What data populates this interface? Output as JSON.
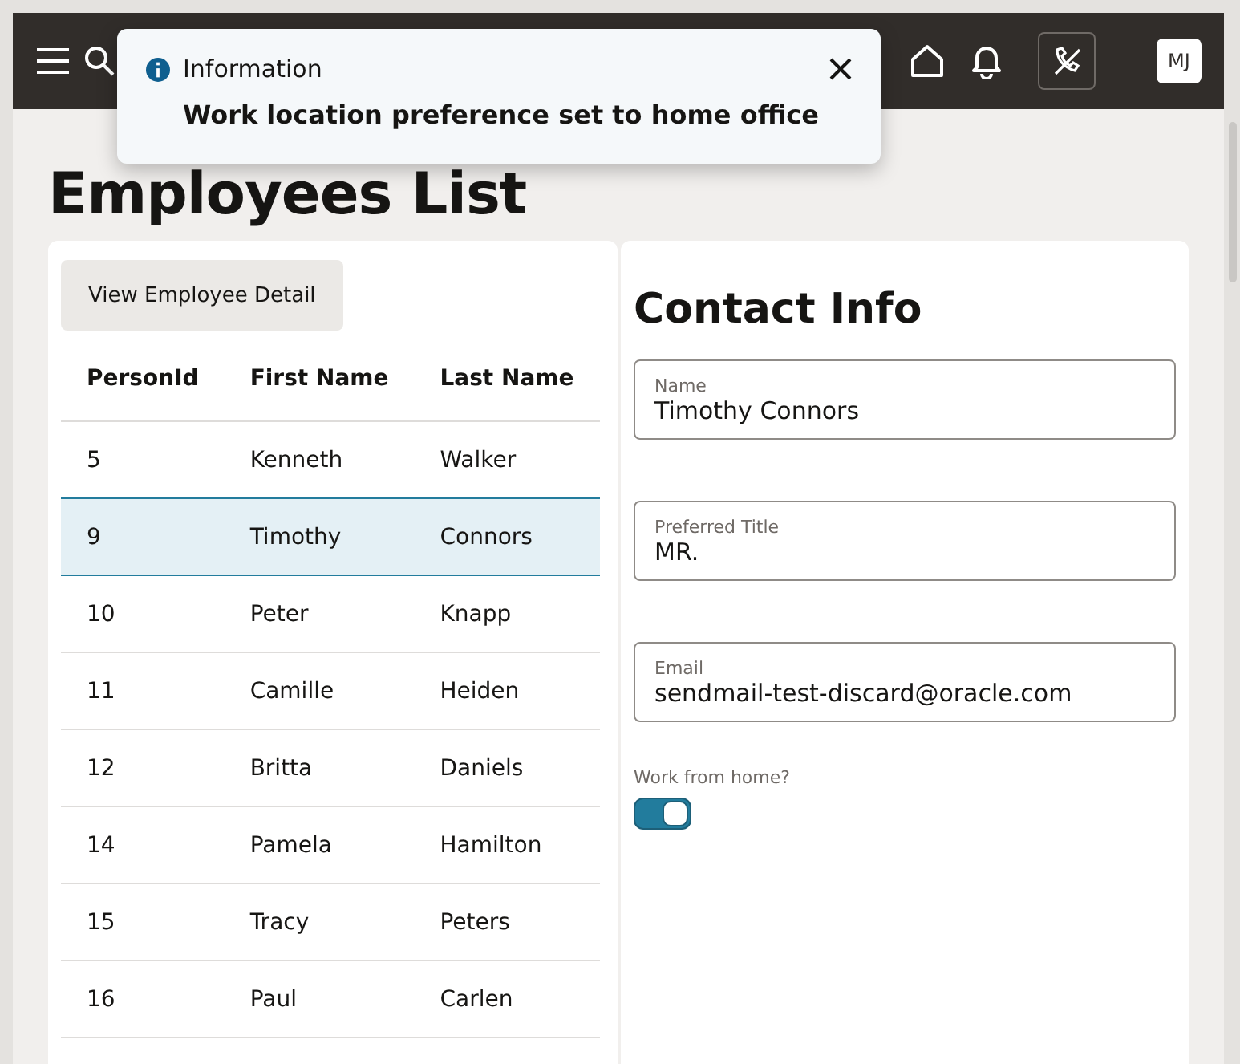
{
  "header": {
    "avatar": "MJ"
  },
  "toast": {
    "title": "Information",
    "message": "Work location preference set to home office"
  },
  "page": {
    "title": "Employees List"
  },
  "list_panel": {
    "button": "View Employee Detail",
    "table": {
      "columns": [
        "PersonId",
        "First Name",
        "Last Name"
      ],
      "rows": [
        {
          "cells": [
            "5",
            "Kenneth",
            "Walker"
          ],
          "selected": false
        },
        {
          "cells": [
            "9",
            "Timothy",
            "Connors"
          ],
          "selected": true
        },
        {
          "cells": [
            "10",
            "Peter",
            "Knapp"
          ],
          "selected": false
        },
        {
          "cells": [
            "11",
            "Camille",
            "Heiden"
          ],
          "selected": false
        },
        {
          "cells": [
            "12",
            "Britta",
            "Daniels"
          ],
          "selected": false
        },
        {
          "cells": [
            "14",
            "Pamela",
            "Hamilton"
          ],
          "selected": false
        },
        {
          "cells": [
            "15",
            "Tracy",
            "Peters"
          ],
          "selected": false
        },
        {
          "cells": [
            "16",
            "Paul",
            "Carlen"
          ],
          "selected": false
        }
      ]
    }
  },
  "contact_panel": {
    "title": "Contact Info",
    "fields": [
      {
        "label": "Name",
        "value": "Timothy Connors"
      },
      {
        "label": "Preferred Title",
        "value": "MR."
      },
      {
        "label": "Email",
        "value": "sendmail-test-discard@oracle.com"
      }
    ],
    "switch": {
      "label": "Work from home?",
      "on": true
    }
  }
}
